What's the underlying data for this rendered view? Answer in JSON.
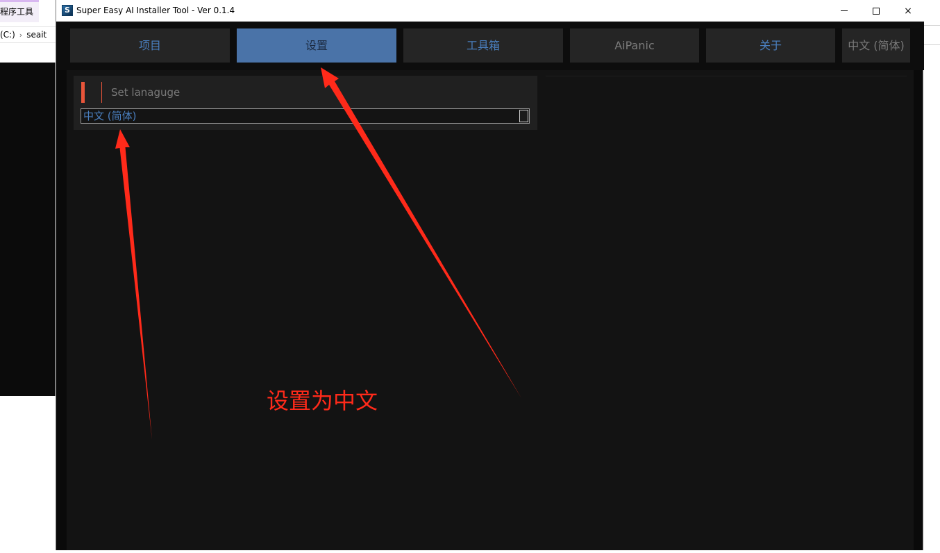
{
  "background_explorer": {
    "ribbon_label": "程序工具",
    "address_drive": "(C:)",
    "address_folder": "seait"
  },
  "window": {
    "title": "Super Easy AI Installer Tool - Ver 0.1.4",
    "icon": "app-logo-icon",
    "controls": {
      "minimize": "minimize-icon",
      "maximize": "maximize-icon",
      "close": "×"
    }
  },
  "tabs": [
    {
      "label": "项目",
      "active": false
    },
    {
      "label": "设置",
      "active": true
    },
    {
      "label": "工具箱",
      "active": false
    },
    {
      "label": "AiPanic",
      "active": false
    },
    {
      "label": "关于",
      "active": false
    },
    {
      "label": "中文 (简体)",
      "active": false
    }
  ],
  "settings": {
    "section_title": "Set lanaguge",
    "language_selected": "中文 (简体)"
  },
  "annotation": {
    "text": "设置为中文",
    "color": "#ff2a1a"
  },
  "colors": {
    "accent": "#e8553a",
    "active_tab": "#4a73a8",
    "link_text": "#4a7fbf",
    "background": "#131313"
  }
}
